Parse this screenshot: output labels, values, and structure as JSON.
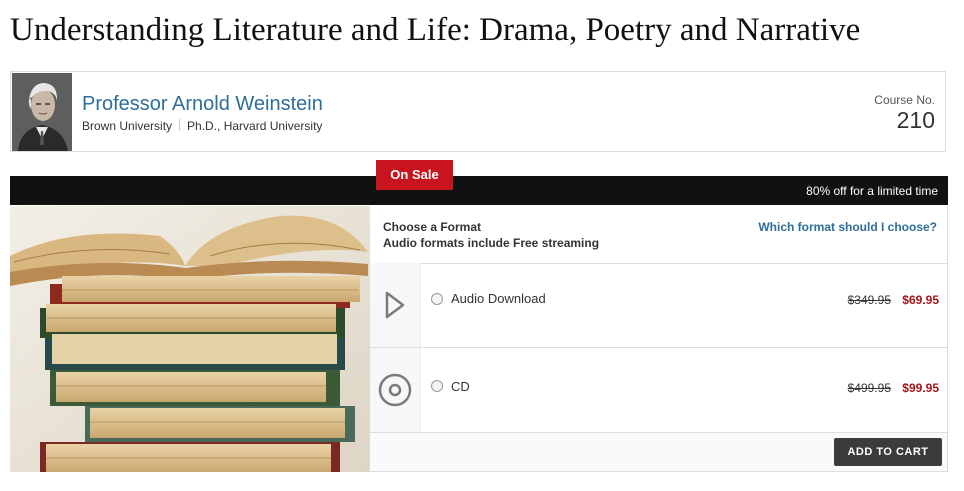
{
  "page": {
    "title": "Understanding Literature and Life: Drama, Poetry and Narrative"
  },
  "professor": {
    "name": "Professor Arnold Weinstein",
    "university": "Brown University",
    "degree": "Ph.D., Harvard University",
    "course_label": "Course No.",
    "course_number": "210"
  },
  "sale": {
    "tag": "On Sale",
    "offer": "80% off for a limited time"
  },
  "formats": {
    "title": "Choose a Format",
    "subtitle": "Audio formats include Free streaming",
    "help_link": "Which format should I choose?",
    "options": [
      {
        "label": "Audio Download",
        "old_price": "$349.95",
        "new_price": "$69.95",
        "icon": "audio-download-icon"
      },
      {
        "label": "CD",
        "old_price": "$499.95",
        "new_price": "$99.95",
        "icon": "cd-icon"
      }
    ],
    "add_to_cart": "ADD TO CART"
  },
  "colors": {
    "accent_link": "#2f6d9a",
    "sale_red": "#c8141e",
    "price_red": "#a8141c",
    "bar_black": "#111111"
  }
}
